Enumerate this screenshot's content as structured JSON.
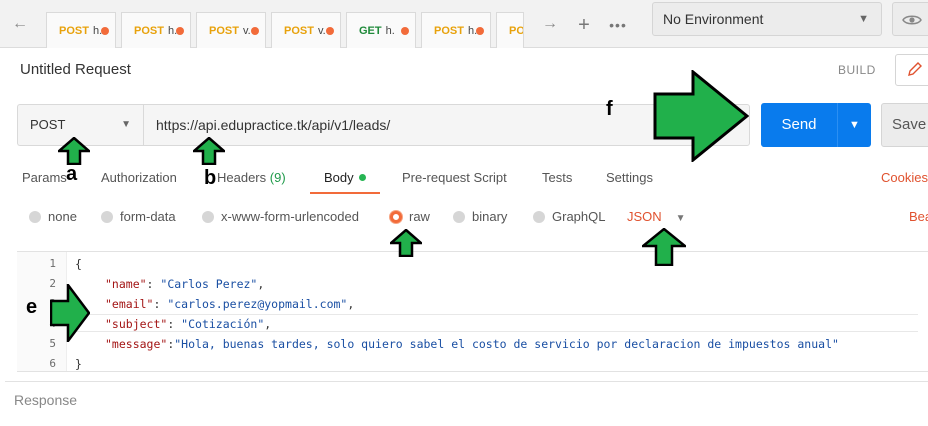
{
  "tabs": [
    {
      "method": "POST",
      "name": "h."
    },
    {
      "method": "POST",
      "name": "h."
    },
    {
      "method": "POST",
      "name": "v."
    },
    {
      "method": "POST",
      "name": "v."
    },
    {
      "method": "GET",
      "name": "h."
    },
    {
      "method": "POST",
      "name": "h."
    },
    {
      "method": "POS",
      "name": ""
    }
  ],
  "tabbar": {
    "back_icon": "←",
    "forward_icon": "→",
    "plus": "+",
    "more": "•••"
  },
  "environment": {
    "selected": "No Environment"
  },
  "request": {
    "title": "Untitled Request",
    "build_label": "BUILD",
    "method": "POST",
    "url": "https://api.edupractice.tk/api/v1/leads/",
    "send_label": "Send",
    "save_label": "Save"
  },
  "subtabs": {
    "params": "Params",
    "authorization": "Authorization",
    "headers": "Headers",
    "headers_count": "(9)",
    "body": "Body",
    "prerequest": "Pre-request Script",
    "tests": "Tests",
    "settings": "Settings",
    "cookies": "Cookies"
  },
  "body_types": {
    "none": "none",
    "form_data": "form-data",
    "urlencoded": "x-www-form-urlencoded",
    "raw": "raw",
    "binary": "binary",
    "graphql": "GraphQL",
    "format": "JSON",
    "beautify": "Bea",
    "selected": "raw"
  },
  "editor": {
    "line_numbers": [
      "1",
      "2",
      "3",
      "4",
      "5",
      "6"
    ],
    "open_brace": "{",
    "close_brace": "}",
    "fields": [
      {
        "key": "\"name\"",
        "sep": ": ",
        "value": "\"Carlos Perez\"",
        "trail": ","
      },
      {
        "key": "\"email\"",
        "sep": ": ",
        "value": "\"carlos.perez@yopmail.com\"",
        "trail": ","
      },
      {
        "key": "\"subject\"",
        "sep": ": ",
        "value": "\"Cotización\"",
        "trail": ","
      },
      {
        "key": "\"message\"",
        "sep": ":",
        "value": "\"Hola, buenas tardes, solo quiero sabel el costo de servicio por declaracion de impuestos anual\"",
        "trail": ""
      }
    ]
  },
  "response": {
    "label": "Response"
  },
  "annotations": {
    "a": "a",
    "b": "b",
    "e": "e",
    "f": "f",
    "arrow_color": "#21b04b"
  }
}
